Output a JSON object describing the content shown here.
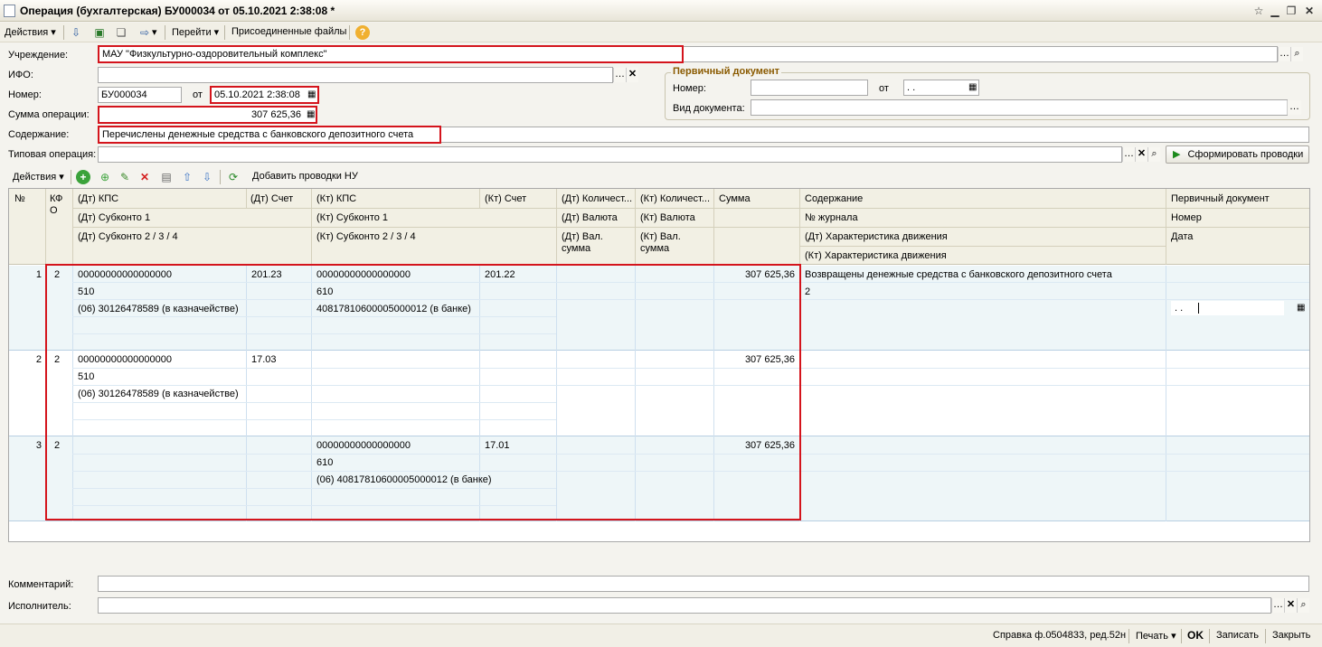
{
  "window": {
    "title": "Операция (бухгалтерская) БУ000034 от 05.10.2021 2:38:08 *",
    "controls": [
      "☆",
      "🗕",
      "🗗",
      "✕"
    ]
  },
  "toolbar": {
    "actions": "Действия",
    "goto": "Перейти",
    "attached": "Присоединенные файлы"
  },
  "form": {
    "institution_label": "Учреждение:",
    "institution_value": "МАУ \"Физкультурно-оздоровительный комплекс\"",
    "ifo_label": "ИФО:",
    "ifo_value": "",
    "number_label": "Номер:",
    "number_value": "БУ000034",
    "from_label": "от",
    "date_value": "05.10.2021  2:38:08",
    "sum_label": "Сумма операции:",
    "sum_value": "307 625,36",
    "content_label": "Содержание:",
    "content_value": "Перечислены денежные средства с банковского депозитного счета",
    "typical_label": "Типовая операция:",
    "typical_value": "",
    "generate_button": "Сформировать проводки"
  },
  "primary_doc": {
    "group_title": "Первичный документ",
    "number_label": "Номер:",
    "number_value": "",
    "from_label": "от",
    "date_value": " .  .",
    "doctype_label": "Вид документа:",
    "doctype_value": ""
  },
  "grid_toolbar": {
    "actions": "Действия",
    "add_nu": "Добавить проводки НУ"
  },
  "grid": {
    "headers": {
      "no": "№",
      "kfo": "КФ О",
      "dt_kps": "(Дт) КПС",
      "dt_account": "(Дт) Счет",
      "kt_kps": "(Кт) КПС",
      "kt_account": "(Кт) Счет",
      "dt_qty": "(Дт) Количест...",
      "kt_qty": "(Кт) Количест...",
      "sum": "Сумма",
      "content": "Содержание",
      "primary_doc": "Первичный документ",
      "dt_sub1": "(Дт) Субконто 1",
      "kt_sub1": "(Кт) Субконто 1",
      "dt_currency": "(Дт) Валюта",
      "kt_currency": "(Кт) Валюта",
      "journal_no": "№ журнала",
      "number": "Номер",
      "dt_sub234": "(Дт) Субконто 2 / 3 / 4",
      "kt_sub234": "(Кт) Субконто 2 / 3 / 4",
      "dt_cur_sum": "(Дт) Вал. сумма",
      "kt_cur_sum": "(Кт) Вал. сумма",
      "dt_movement": "(Дт) Характеристика движения",
      "kt_movement": "(Кт) Характеристика движения",
      "date": "Дата"
    },
    "rows": [
      {
        "no": "1",
        "kfo": "2",
        "dt_kps": "00000000000000000",
        "dt_account": "201.23",
        "kt_kps": "00000000000000000",
        "kt_account": "201.22",
        "dt_sub1": "510",
        "kt_sub1": "610",
        "dt_sub234": "(06) 30126478589 (в казначействе)",
        "kt_sub234": "40817810600005000012 (в банке)",
        "sum": "307 625,36",
        "content": "Возвращены денежные средства с банковского депозитного счета",
        "journal_no": "2",
        "date": " .  ."
      },
      {
        "no": "2",
        "kfo": "2",
        "dt_kps": "00000000000000000",
        "dt_account": "17.03",
        "kt_kps": "",
        "kt_account": "",
        "dt_sub1": "510",
        "kt_sub1": "",
        "dt_sub234": "(06) 30126478589 (в казначействе)",
        "kt_sub234": "",
        "sum": "307 625,36",
        "content": "",
        "journal_no": "",
        "date": ""
      },
      {
        "no": "3",
        "kfo": "2",
        "dt_kps": "",
        "dt_account": "",
        "kt_kps": "00000000000000000",
        "kt_account": "17.01",
        "dt_sub1": "",
        "kt_sub1": "610",
        "dt_sub234": "",
        "kt_sub234": "(06) 40817810600005000012 (в банке)",
        "sum": "307 625,36",
        "content": "",
        "journal_no": "",
        "date": ""
      }
    ]
  },
  "footer": {
    "comment_label": "Комментарий:",
    "comment_value": "",
    "executor_label": "Исполнитель:",
    "executor_value": ""
  },
  "statusbar": {
    "help": "Справка ф.0504833, ред.52н",
    "print": "Печать",
    "ok": "OK",
    "save": "Записать",
    "close": "Закрыть"
  },
  "colors": {
    "highlight": "#d4141c",
    "group_title": "#8a5a00",
    "row_bg": "#eef6f8"
  }
}
